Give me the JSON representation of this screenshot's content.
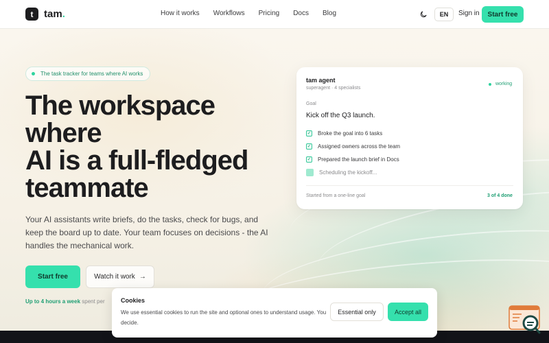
{
  "nav": {
    "logo_letter": "t",
    "logo_name": "tam",
    "logo_dot": ".",
    "links": [
      "How it works",
      "Workflows",
      "Pricing",
      "Docs",
      "Blog"
    ],
    "lang": "EN",
    "signin": "Sign in",
    "cta": "Start free"
  },
  "hero": {
    "pill": "The task tracker for teams where AI works",
    "headline": [
      "The workspace",
      "where",
      "AI is a full-fledged",
      "teammate"
    ],
    "subcopy": "Your AI assistants write briefs, do the tasks, check for bugs, and keep the board up to date. Your team focuses on decisions - the AI handles the mechanical work.",
    "cta_primary": "Start free",
    "cta_secondary": "Watch it work",
    "cta_secondary_arrow": "→",
    "saving_bold": "Up to 4 hours a week",
    "saving_rest": " spent per"
  },
  "agent_card": {
    "title": "tam agent",
    "subtitle": "superagent · 4 specialists",
    "status": "working",
    "goal_label": "Goal",
    "goal": "Kick off the Q3 launch.",
    "tasks": [
      {
        "label": "Broke the goal into 6 tasks",
        "done": true
      },
      {
        "label": "Assigned owners across the team",
        "done": true
      },
      {
        "label": "Prepared the launch brief in Docs",
        "done": true
      },
      {
        "label": "Scheduling the kickoff...",
        "done": false
      }
    ],
    "footer_left": "Started from a one-line goal",
    "footer_right": "3 of 4 done"
  },
  "cookie": {
    "title": "Cookies",
    "text": "We use essential cookies to run the site and optional ones to understand usage. You decide.",
    "essential": "Essential only",
    "accept": "Accept all"
  },
  "colors": {
    "accent": "#35e0ad",
    "accent_text": "#1f9f74",
    "dark": "#1d1d1f"
  }
}
